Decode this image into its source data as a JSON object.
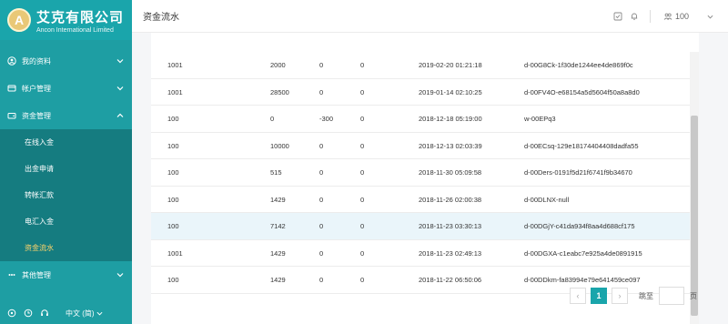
{
  "brand": {
    "title": "艾克有限公司",
    "subtitle": "Ancon International Limited",
    "logo_letter": "A"
  },
  "sidebar": {
    "groups": [
      {
        "label": "我的资料",
        "icon": "user-circle-icon"
      },
      {
        "label": "帐户管理",
        "icon": "account-icon"
      },
      {
        "label": "资金管理",
        "icon": "wallet-icon"
      }
    ],
    "sub_items": [
      {
        "label": "在线入金",
        "active": false
      },
      {
        "label": "出金申请",
        "active": false
      },
      {
        "label": "转帐汇款",
        "active": false
      },
      {
        "label": "电汇入金",
        "active": false
      },
      {
        "label": "资金流水",
        "active": true
      }
    ],
    "other_group": {
      "label": "其他管理",
      "icon": "grid-icon"
    },
    "footer": {
      "language": "中文 (简)"
    }
  },
  "header": {
    "title": "资金流水",
    "user_count": "100"
  },
  "table": {
    "rows": [
      [
        "1001",
        "2000",
        "0",
        "0",
        "2019-02-20 01:21:18",
        "d-00G8Ck-1f30de1244ee4de869f0c"
      ],
      [
        "1001",
        "28500",
        "0",
        "0",
        "2019-01-14 02:10:25",
        "d-00FV4O-e68154a5d5604f50a8a8d0"
      ],
      [
        "100",
        "0",
        "-300",
        "0",
        "2018-12-18 05:19:00",
        "w-00EPq3"
      ],
      [
        "100",
        "10000",
        "0",
        "0",
        "2018-12-13 02:03:39",
        "d-00ECsq-129e18174404408dadfa55"
      ],
      [
        "100",
        "515",
        "0",
        "0",
        "2018-11-30 05:09:58",
        "d-00Ders-0191f5d21f6741f9b34670"
      ],
      [
        "100",
        "1429",
        "0",
        "0",
        "2018-11-26 02:00:38",
        "d-00DLNX-null"
      ],
      [
        "100",
        "7142",
        "0",
        "0",
        "2018-11-23 03:30:13",
        "d-00DGjY-c41da934f8aa4d688cf175"
      ],
      [
        "1001",
        "1429",
        "0",
        "0",
        "2018-11-23 02:49:13",
        "d-00DGXA-c1eabc7e925a4de0891915"
      ],
      [
        "100",
        "1429",
        "0",
        "0",
        "2018-11-22 06:50:06",
        "d-00DDkm-fa83994e79e641459ce097"
      ]
    ],
    "highlight_row": 6
  },
  "pagination": {
    "current_page": "1",
    "prev": "‹",
    "next": "›",
    "goto_label": "跳至",
    "goto_value": "",
    "goto_unit": "页"
  },
  "colors": {
    "sidebar": "#1e9ea3",
    "submenu": "#157c80",
    "accent": "#1aa5ab",
    "active_text": "#ffd46a",
    "row_highlight": "#eaf5fa"
  }
}
